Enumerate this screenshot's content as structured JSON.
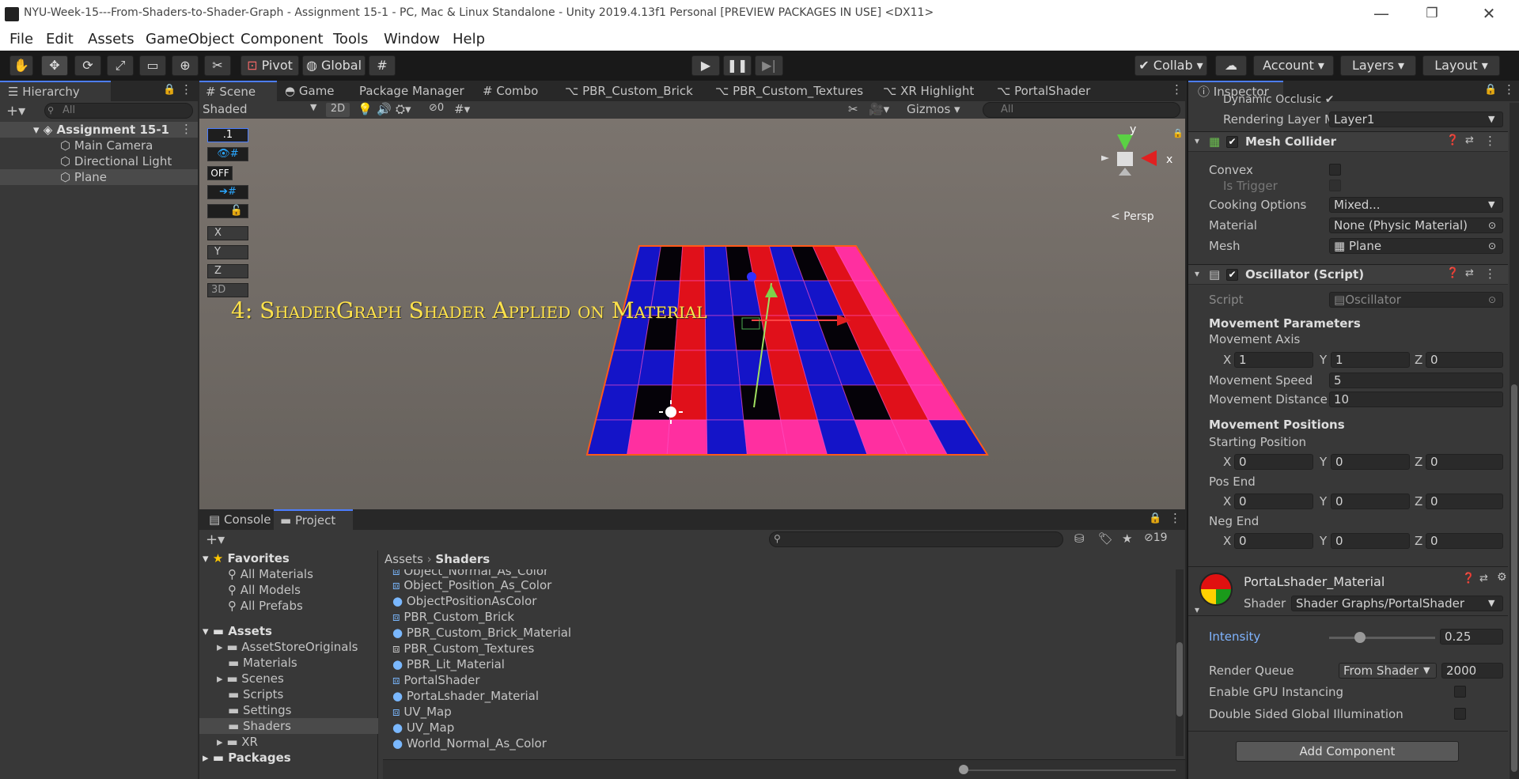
{
  "window": {
    "title": "NYU-Week-15---From-Shaders-to-Shader-Graph - Assignment 15-1 - PC, Mac & Linux Standalone - Unity 2019.4.13f1 Personal [PREVIEW PACKAGES IN USE] <DX11>",
    "min": "—",
    "max": "❐",
    "close": "✕"
  },
  "menu": [
    "File",
    "Edit",
    "Assets",
    "GameObject",
    "Component",
    "Tools",
    "Window",
    "Help"
  ],
  "toolbar": {
    "pivot": "Pivot",
    "global": "Global",
    "collab": "Collab",
    "account": "Account",
    "layers": "Layers",
    "layout": "Layout"
  },
  "hierarchy": {
    "tab": "Hierarchy",
    "search_placeholder": "All",
    "scene": "Assignment 15-1",
    "items": [
      "Main Camera",
      "Directional Light",
      "Plane"
    ]
  },
  "scene_tabs": [
    "Scene",
    "Game",
    "Package Manager",
    "Combo",
    "PBR_Custom_Brick",
    "PBR_Custom_Textures",
    "XR Highlight",
    "PortalShader"
  ],
  "scene_toolbar": {
    "shading": "Shaded",
    "mode2d": "2D",
    "hidden_count": "0",
    "gizmos": "Gizmos",
    "search_placeholder": "All"
  },
  "scene_view": {
    "overlay_text": "4: ShaderGraph Shader Applied on Material",
    "scale_value": ".1",
    "off_label": "OFF",
    "axis_x": "X",
    "axis_y": "Y",
    "axis_z": "Z",
    "label_3d": "3D",
    "gizmo_y": "y",
    "gizmo_x": "x",
    "persp": "< Persp"
  },
  "bottom_tabs": [
    "Console",
    "Project"
  ],
  "project": {
    "hidden_count": "19",
    "favorites": "Favorites",
    "favorite_items": [
      "All Materials",
      "All Models",
      "All Prefabs"
    ],
    "assets": "Assets",
    "asset_folders": [
      "AssetStoreOriginals",
      "Materials",
      "Scenes",
      "Scripts",
      "Settings",
      "Shaders",
      "XR"
    ],
    "packages": "Packages",
    "breadcrumb": [
      "Assets",
      "Shaders"
    ],
    "files": [
      "Object_Normal_As_Color",
      "Object_Position_As_Color",
      "ObjectPositionAsColor",
      "PBR_Custom_Brick",
      "PBR_Custom_Brick_Material",
      "PBR_Custom_Textures",
      "PBR_Lit_Material",
      "PortalShader",
      "PortaLshader_Material",
      "UV_Map",
      "UV_Map",
      "World_Normal_As_Color"
    ]
  },
  "inspector": {
    "tab": "Inspector",
    "dynamic_occlusion": "Dynamic Occlusic",
    "rendering_layer_label": "Rendering Layer M",
    "rendering_layer_value": "Layer1",
    "mesh_collider": {
      "title": "Mesh Collider",
      "convex": "Convex",
      "is_trigger": "Is Trigger",
      "cooking_label": "Cooking Options",
      "cooking_value": "Mixed...",
      "material_label": "Material",
      "material_value": "None (Physic Material)",
      "mesh_label": "Mesh",
      "mesh_value": "Plane"
    },
    "oscillator": {
      "title": "Oscillator (Script)",
      "script_label": "Script",
      "script_value": "Oscillator",
      "movement_params": "Movement Parameters",
      "movement_axis": "Movement Axis",
      "axis": {
        "x": "1",
        "y": "1",
        "z": "0"
      },
      "speed_label": "Movement Speed",
      "speed_value": "5",
      "distance_label": "Movement Distance",
      "distance_value": "10",
      "positions": "Movement Positions",
      "starting": "Starting Position",
      "start": {
        "x": "0",
        "y": "0",
        "z": "0"
      },
      "pos_end": "Pos End",
      "posend": {
        "x": "0",
        "y": "0",
        "z": "0"
      },
      "neg_end": "Neg End",
      "negend": {
        "x": "0",
        "y": "0",
        "z": "0"
      }
    },
    "material": {
      "name": "PortaLshader_Material",
      "shader_label": "Shader",
      "shader_value": "Shader Graphs/PortalShader",
      "intensity_label": "Intensity",
      "intensity_value": "0.25",
      "render_queue_label": "Render Queue",
      "render_queue_mode": "From Shader",
      "render_queue_value": "2000",
      "gpu_instancing": "Enable GPU Instancing",
      "double_sided": "Double Sided Global Illumination"
    },
    "add_component": "Add Component",
    "xyz": {
      "x": "X",
      "y": "Y",
      "z": "Z"
    }
  },
  "colors": {
    "accent": "#4c7eff",
    "overlay_text": "#ffe24a",
    "tile_red": "#e0101a",
    "tile_blue": "#1414c8",
    "tile_black": "#050208",
    "tile_magenta": "#ff2fa0"
  }
}
